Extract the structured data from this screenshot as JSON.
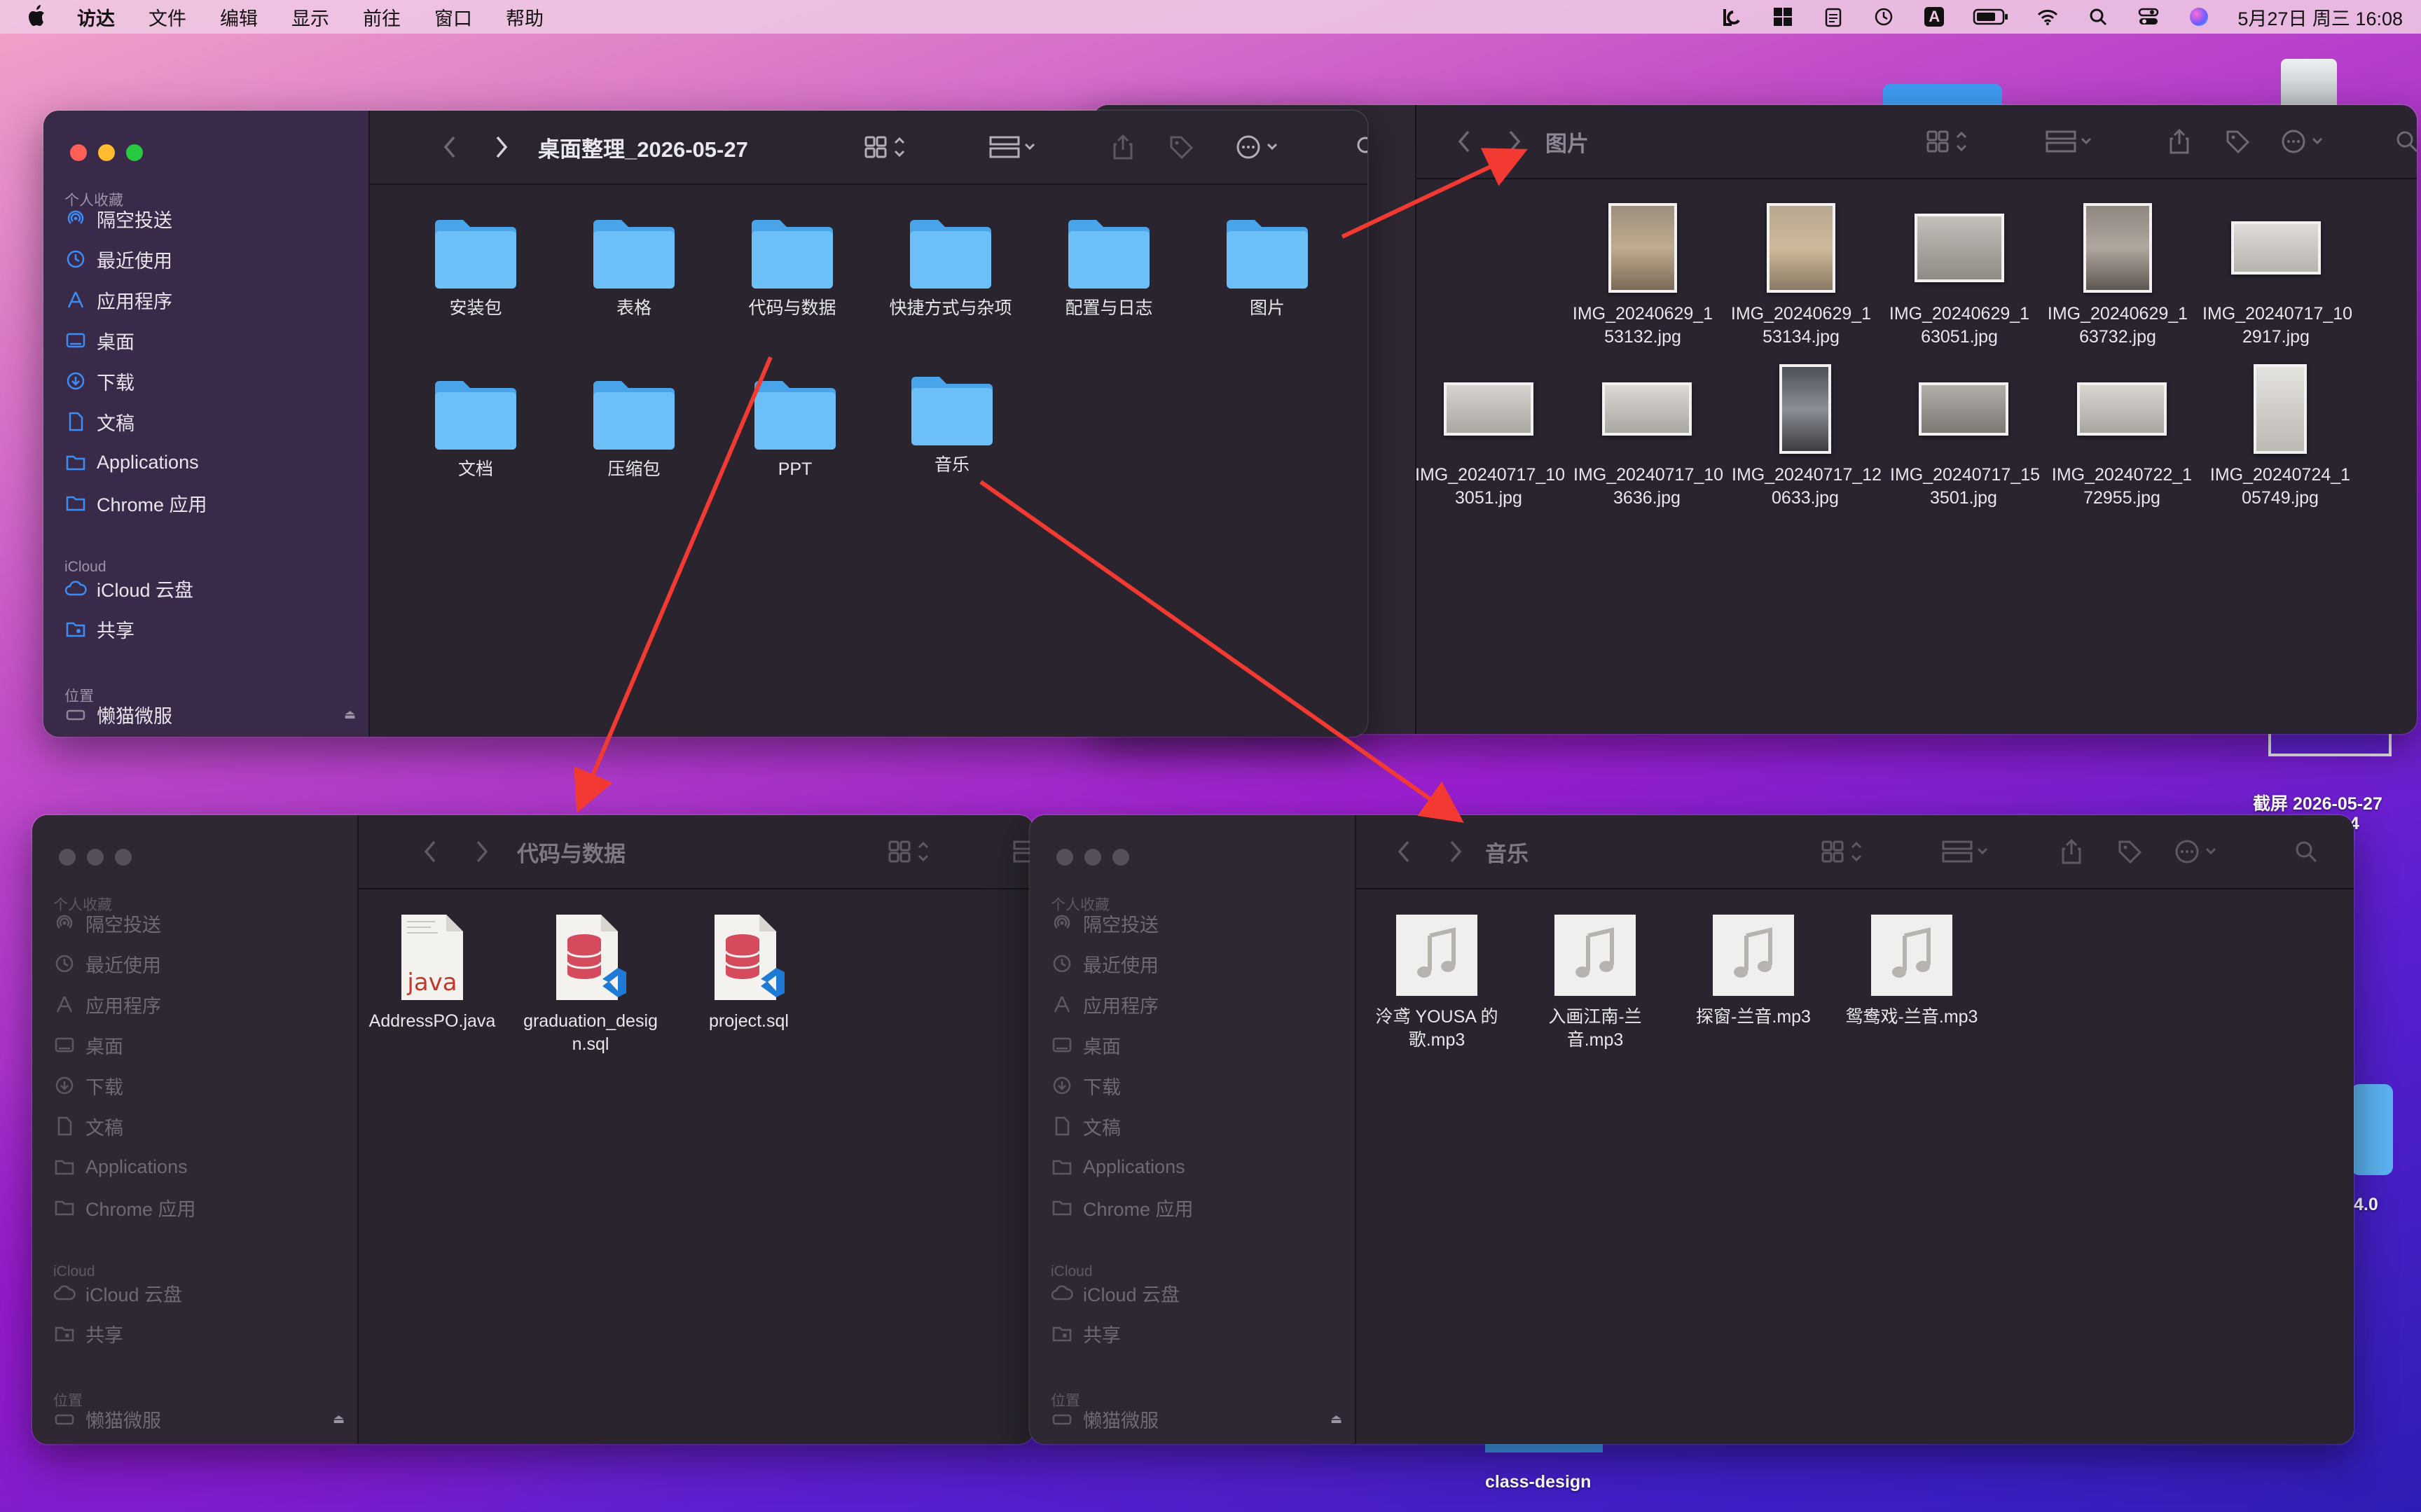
{
  "menubar": {
    "app_name": "访达",
    "menus": [
      "文件",
      "编辑",
      "显示",
      "前往",
      "窗口",
      "帮助"
    ],
    "clock": "5月27日 周三 16:08",
    "status_icons": [
      "lc-icon",
      "grid-icon",
      "clipboard-icon",
      "time-machine-icon",
      "input-method-icon",
      "battery-icon",
      "wifi-icon",
      "search-icon",
      "control-center-icon",
      "siri-icon"
    ],
    "input_method_label": "A"
  },
  "sidebar": {
    "favorites_header": "个人收藏",
    "favorites": [
      {
        "label": "隔空投送",
        "icon": "airdrop-icon"
      },
      {
        "label": "最近使用",
        "icon": "clock-icon"
      },
      {
        "label": "应用程序",
        "icon": "applications-icon"
      },
      {
        "label": "桌面",
        "icon": "desktop-icon"
      },
      {
        "label": "下载",
        "icon": "download-icon"
      },
      {
        "label": "文稿",
        "icon": "document-icon"
      },
      {
        "label": "Applications",
        "icon": "folder-icon"
      },
      {
        "label": "Chrome 应用",
        "icon": "folder-icon"
      }
    ],
    "icloud_header": "iCloud",
    "icloud": [
      {
        "label": "iCloud 云盘",
        "icon": "cloud-icon"
      },
      {
        "label": "共享",
        "icon": "shared-folder-icon"
      }
    ],
    "locations_header": "位置",
    "locations": [
      {
        "label": "懒猫微服",
        "icon": "disk-icon"
      }
    ]
  },
  "windows": {
    "main": {
      "title": "桌面整理_2026-05-27",
      "folders": [
        "安装包",
        "表格",
        "代码与数据",
        "快捷方式与杂项",
        "配置与日志",
        "图片",
        "文档",
        "压缩包",
        "PPT",
        "音乐"
      ]
    },
    "pictures": {
      "title": "图片",
      "files": [
        [
          "IMG_20240629_1",
          "53132.jpg"
        ],
        [
          "IMG_20240629_1",
          "53134.jpg"
        ],
        [
          "IMG_20240629_1",
          "63051.jpg"
        ],
        [
          "IMG_20240629_1",
          "63732.jpg"
        ],
        [
          "IMG_20240717_10",
          "2917.jpg"
        ],
        [
          "IMG_20240717_10",
          "3051.jpg"
        ],
        [
          "IMG_20240717_10",
          "3636.jpg"
        ],
        [
          "IMG_20240717_12",
          "0633.jpg"
        ],
        [
          "IMG_20240717_15",
          "3501.jpg"
        ],
        [
          "IMG_20240722_1",
          "72955.jpg"
        ],
        [
          "IMG_20240724_1",
          "05749.jpg"
        ]
      ]
    },
    "code": {
      "title": "代码与数据",
      "files": [
        {
          "line1": "AddressPO.java",
          "line2": "",
          "kind": "java"
        },
        {
          "line1": "graduation_desig",
          "line2": "n.sql",
          "kind": "sql"
        },
        {
          "line1": "project.sql",
          "line2": "",
          "kind": "sql"
        }
      ],
      "java_badge": "java"
    },
    "music": {
      "title": "音乐",
      "files": [
        [
          "泠鸢 YOUSA 的",
          "歌.mp3"
        ],
        [
          "入画江南-兰",
          "音.mp3"
        ],
        [
          "探窗-兰音.mp3",
          ""
        ],
        [
          "鸳鸯戏-兰音.mp3",
          ""
        ]
      ]
    }
  },
  "desktop": {
    "screenshot_label_1": "截屏 2026-05-27",
    "screenshot_label_2": "4",
    "version_label": "4.0",
    "folder_label": "class-design"
  },
  "colors": {
    "folder_blue": "#5cb3f2",
    "accent_blue": "#3a8df5",
    "arrow_red": "#f23a32"
  }
}
